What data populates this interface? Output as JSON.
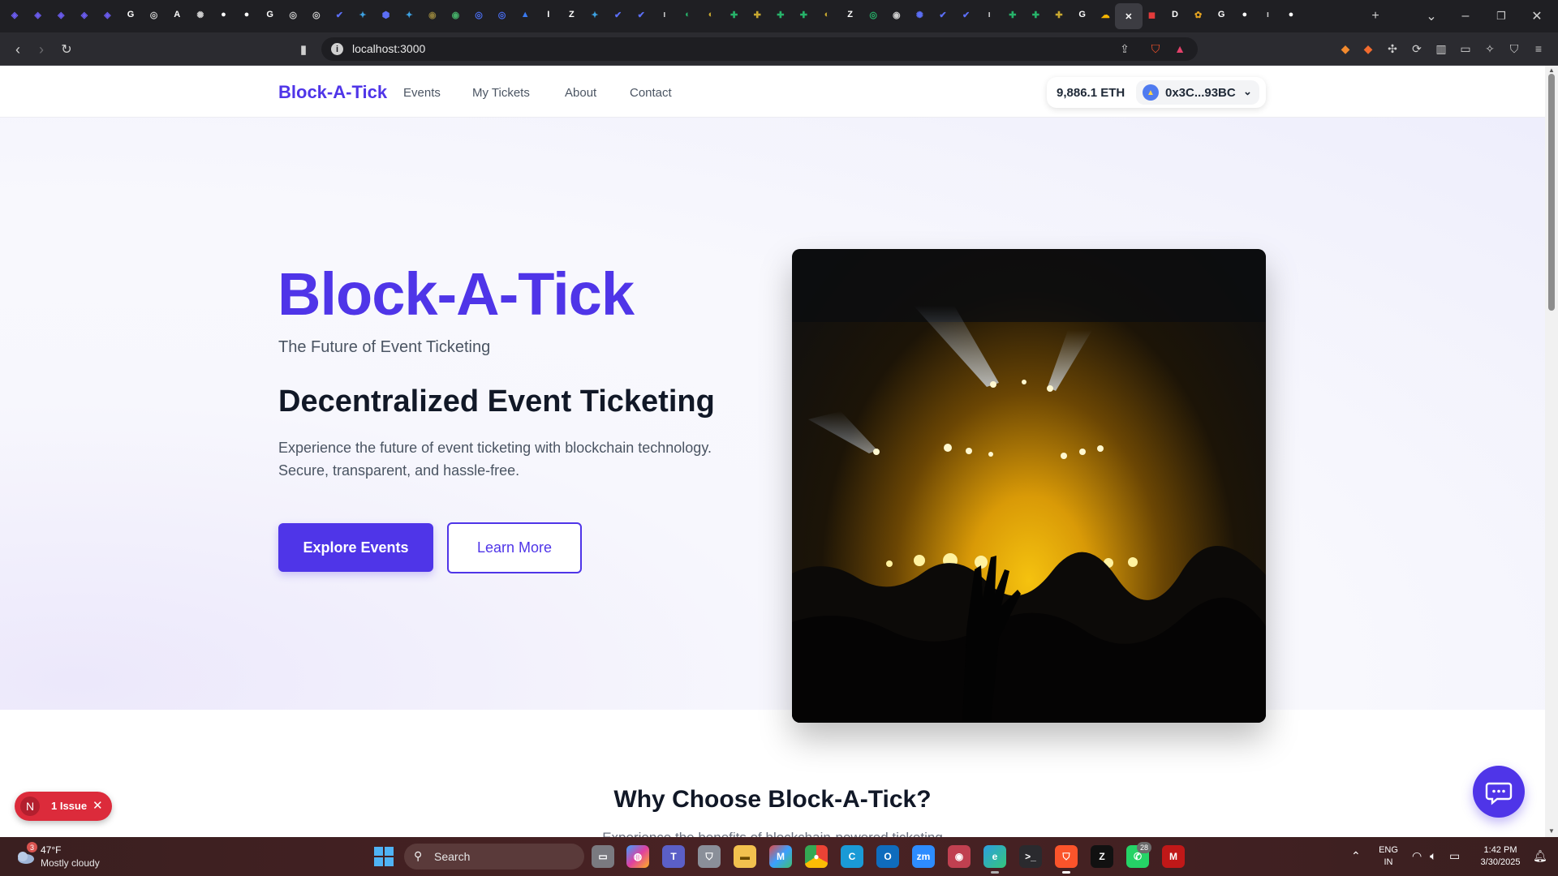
{
  "browser": {
    "url": "localhost:3000",
    "tabs": [
      {
        "icon": "brand-icon",
        "color": "#6b5cf0",
        "glyph": "◈"
      },
      {
        "icon": "brand-icon",
        "color": "#6b5cf0",
        "glyph": "◈"
      },
      {
        "icon": "brand-icon",
        "color": "#6b5cf0",
        "glyph": "◈"
      },
      {
        "icon": "brand-icon",
        "color": "#6b5cf0",
        "glyph": "◈"
      },
      {
        "icon": "brand-icon",
        "color": "#6b5cf0",
        "glyph": "◈"
      },
      {
        "icon": "google-icon",
        "color": "#ffffff",
        "glyph": "G"
      },
      {
        "icon": "settings-icon",
        "color": "#cccccc",
        "glyph": "◎"
      },
      {
        "icon": "a-logo-icon",
        "color": "#ffffff",
        "glyph": "A"
      },
      {
        "icon": "openai-icon",
        "color": "#cccccc",
        "glyph": "✺"
      },
      {
        "icon": "github-icon",
        "color": "#ffffff",
        "glyph": "●"
      },
      {
        "icon": "github-icon",
        "color": "#ffffff",
        "glyph": "●"
      },
      {
        "icon": "google-icon",
        "color": "#ffffff",
        "glyph": "G"
      },
      {
        "icon": "settings-icon",
        "color": "#cccccc",
        "glyph": "◎"
      },
      {
        "icon": "settings-icon",
        "color": "#cccccc",
        "glyph": "◎"
      },
      {
        "icon": "bird-icon",
        "color": "#5b6ef5",
        "glyph": "✔"
      },
      {
        "icon": "globe-icon",
        "color": "#3da0e0",
        "glyph": "✦"
      },
      {
        "icon": "shield-icon",
        "color": "#5b6ef5",
        "glyph": "⬢"
      },
      {
        "icon": "globe-icon",
        "color": "#3da0e0",
        "glyph": "✦"
      },
      {
        "icon": "coin-icon",
        "color": "#8a7a3a",
        "glyph": "◉"
      },
      {
        "icon": "circle-icon",
        "color": "#44aa66",
        "glyph": "◉"
      },
      {
        "icon": "circle-icon",
        "color": "#4a6ef0",
        "glyph": "◎"
      },
      {
        "icon": "circle-icon",
        "color": "#4a6ef0",
        "glyph": "◎"
      },
      {
        "icon": "triangle-icon",
        "color": "#3a7af0",
        "glyph": "▲"
      },
      {
        "icon": "dark-icon",
        "color": "#ffffff",
        "glyph": "I"
      },
      {
        "icon": "dark-icon",
        "color": "#ffffff",
        "glyph": "Z"
      },
      {
        "icon": "globe-icon",
        "color": "#3da0e0",
        "glyph": "✦"
      },
      {
        "icon": "bird-icon",
        "color": "#5b6ef5",
        "glyph": "✔"
      },
      {
        "icon": "bird-icon",
        "color": "#5b6ef5",
        "glyph": "✔"
      },
      {
        "icon": "n-icon",
        "color": "#cccccc",
        "glyph": "ı"
      },
      {
        "icon": "leaf-icon",
        "color": "#27b36a",
        "glyph": "◐"
      },
      {
        "icon": "leaf-icon",
        "color": "#c8a830",
        "glyph": "◐"
      },
      {
        "icon": "leaf-icon",
        "color": "#27b36a",
        "glyph": "✚"
      },
      {
        "icon": "leaf-icon",
        "color": "#c8a830",
        "glyph": "✚"
      },
      {
        "icon": "leaf-icon",
        "color": "#27b36a",
        "glyph": "✚"
      },
      {
        "icon": "leaf-icon",
        "color": "#27b36a",
        "glyph": "✚"
      },
      {
        "icon": "leaf-icon",
        "color": "#c8a830",
        "glyph": "◐"
      },
      {
        "icon": "dark-icon",
        "color": "#ffffff",
        "glyph": "Z"
      },
      {
        "icon": "circle-icon",
        "color": "#27b36a",
        "glyph": "◎"
      },
      {
        "icon": "circle-icon",
        "color": "#cccccc",
        "glyph": "◉"
      },
      {
        "icon": "circle-icon",
        "color": "#5b6ef5",
        "glyph": "✺"
      },
      {
        "icon": "bird-icon",
        "color": "#5b6ef5",
        "glyph": "✔"
      },
      {
        "icon": "bird-icon",
        "color": "#5b6ef5",
        "glyph": "✔"
      },
      {
        "icon": "n-icon",
        "color": "#cccccc",
        "glyph": "ı"
      },
      {
        "icon": "leaf-icon",
        "color": "#27b36a",
        "glyph": "✚"
      },
      {
        "icon": "leaf-icon",
        "color": "#27b36a",
        "glyph": "✚"
      },
      {
        "icon": "leaf-icon",
        "color": "#c8a830",
        "glyph": "✚"
      },
      {
        "icon": "google-icon",
        "color": "#ffffff",
        "glyph": "G"
      },
      {
        "icon": "cloud-icon",
        "color": "#f4b400",
        "glyph": "☁"
      },
      {
        "icon": "close-icon",
        "color": "#ffffff",
        "glyph": "✕",
        "active": true
      },
      {
        "icon": "red-icon",
        "color": "#e23b3b",
        "glyph": "◼"
      },
      {
        "icon": "d-icon",
        "color": "#ffffff",
        "glyph": "D"
      },
      {
        "icon": "colorful-icon",
        "color": "#e0a020",
        "glyph": "✿"
      },
      {
        "icon": "google-icon",
        "color": "#ffffff",
        "glyph": "G"
      },
      {
        "icon": "github-icon",
        "color": "#ffffff",
        "glyph": "●"
      },
      {
        "icon": "n-icon",
        "color": "#cccccc",
        "glyph": "ı"
      },
      {
        "icon": "github-icon",
        "color": "#ffffff",
        "glyph": "●"
      }
    ]
  },
  "site": {
    "brand": "Block-A-Tick",
    "nav": [
      "Events",
      "My Tickets",
      "About",
      "Contact"
    ],
    "wallet": {
      "balance": "9,886.1 ETH",
      "address": "0x3C...93BC"
    }
  },
  "hero": {
    "title": "Block-A-Tick",
    "tagline": "The Future of Event Ticketing",
    "heading": "Decentralized Event Ticketing",
    "description": "Experience the future of event ticketing with blockchain technology. Secure, transparent, and hassle-free.",
    "primary_button": "Explore Events",
    "secondary_button": "Learn More"
  },
  "why": {
    "title": "Why Choose Block-A-Tick?",
    "subtitle": "Experience the benefits of blockchain-powered ticketing"
  },
  "issue_badge": {
    "initial": "N",
    "label": "1 Issue"
  },
  "taskbar": {
    "weather": {
      "temp": "47°F",
      "desc": "Mostly cloudy",
      "badge": "3"
    },
    "search_placeholder": "Search",
    "language": {
      "line1": "ENG",
      "line2": "IN"
    },
    "clock": {
      "time": "1:42 PM",
      "date": "3/30/2025"
    },
    "whatsapp_badge": "28"
  }
}
